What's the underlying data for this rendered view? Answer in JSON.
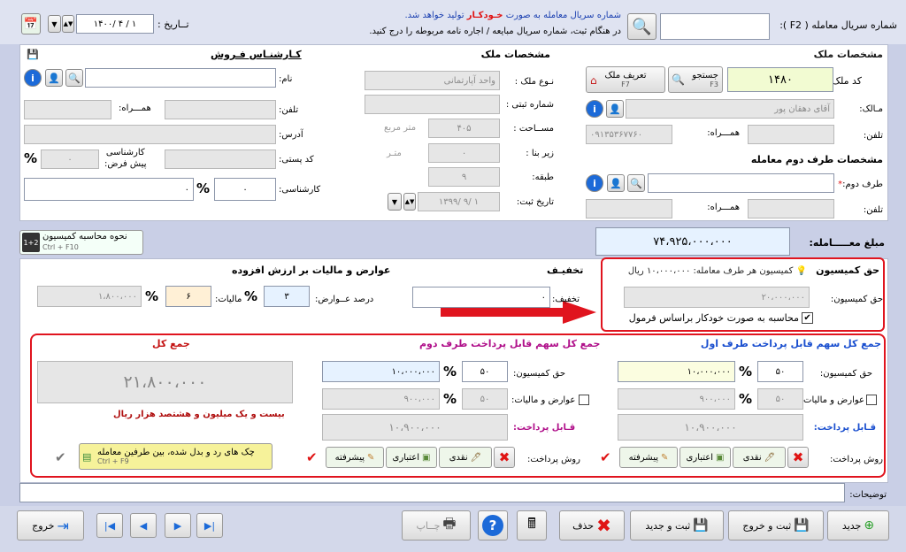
{
  "top": {
    "serial_label": "شماره سریال معامله ( F2 ):",
    "serial_value": "",
    "note1_a": "شماره سریال معامله به صورت",
    "note1_b": "خـودکـار",
    "note1_c": "تولید خواهد شد.",
    "note2": "در هنگام ثبت، شماره سریال مبایعه / اجاره نامه مربوطه را درج کنید.",
    "date_label": "تــاریخ :",
    "date_value": "۱۴۰۰/ ۴ / ۱"
  },
  "property": {
    "title": "مشخصات ملک",
    "code_label": "کد ملک :",
    "code_value": "۱۴۸۰",
    "search_btn": "جستجو",
    "search_key": "F3",
    "define_btn": "تعریف ملک",
    "define_key": "F7",
    "owner_label": "مـالک:",
    "owner_value": "آقای دهقان پور",
    "phone_label": "تلفن:",
    "mobile_label": "همـــراه:",
    "mobile_value": "۰۹۱۳۵۳۶۷۷۶۰"
  },
  "second_party": {
    "title": "مشخصات طرف دوم معامله",
    "party_label": "طرف دوم:",
    "phone_label": "تلفن:",
    "mobile_label": "همـــراه:"
  },
  "details": {
    "title": "مشخصات ملک",
    "type_label": "نـوع ملک :",
    "type_value": "واحد آپارتمانی",
    "reg_label": "شماره ثبتی :",
    "area_label": "مســاحت :",
    "area_value": "۴۰۵",
    "area_unit": "متر مربع",
    "built_label": "زیر بنا :",
    "built_value": "۰",
    "built_unit": "متـر",
    "floor_label": "طبقه:",
    "floor_value": "۹",
    "regdate_label": "تاریخ ثبت:",
    "regdate_value": "۱۳۹۹/ ۹/ ۱"
  },
  "agent": {
    "title": "کـارشنـاس فـروش",
    "name_label": "نام:",
    "phone_label": "تلفن:",
    "mobile_label": "همـــراه:",
    "address_label": "آدرس:",
    "postal_label": "کد پستی:",
    "default_label_1": "کارشناسی",
    "default_label_2": "پیش فرض:",
    "default_value": "۰",
    "expert_label": "کارشناسی:",
    "expert_pct": "۰",
    "expert_amount": "۰"
  },
  "calc_btn": {
    "label": "نحوه محاسبه کمیسیون",
    "key": "Ctrl + F10"
  },
  "amount": {
    "label": "مبلغ معـــــامله:",
    "value": "۷۴،۹۲۵،۰۰۰،۰۰۰"
  },
  "commission": {
    "title": "حق کمیسیون",
    "hint": "کمیسیون هر طرف معامله: ۱۰،۰۰۰،۰۰۰ ریال",
    "label": "حق کمیسیون:",
    "value": "۲۰،۰۰۰،۰۰۰",
    "auto_label": "محاسبه به صورت خودکار براساس فرمول"
  },
  "discount": {
    "title": "تخفیـف",
    "label": "تخفیف:",
    "value": "۰"
  },
  "tax": {
    "title": "عوارض و مالیات بر ارزش افزوده",
    "duty_label": "درصد عــوارض:",
    "duty_value": "۳",
    "tax_label": "مالیات:",
    "tax_value": "۶",
    "total_value": "۱،۸۰۰،۰۰۰"
  },
  "party1": {
    "title": "جمع کل سهم قابل پرداخت طرف اول",
    "comm_label": "حق کمیسیون:",
    "pct": "۵۰",
    "comm_value": "۱۰،۰۰۰،۰۰۰",
    "tax_label": "عوارض و مالیات:",
    "tax_pct": "۵۰",
    "tax_value": "۹۰۰،۰۰۰",
    "pay_label": "قـابل پرداخت:",
    "pay_value": "۱۰،۹۰۰،۰۰۰",
    "method_label": "روش پرداخت:",
    "cash": "نقدی",
    "credit": "اعتباری",
    "advanced": "پیشرفته"
  },
  "party2": {
    "title": "جمع کل سهم قابل پرداخت طرف دوم",
    "comm_label": "حق کمیسیون:",
    "pct": "۵۰",
    "comm_value": "۱۰،۰۰۰،۰۰۰",
    "tax_label": "عوارض و مالیات:",
    "tax_pct": "۵۰",
    "tax_value": "۹۰۰،۰۰۰",
    "pay_label": "قـابل پرداخت:",
    "pay_value": "۱۰،۹۰۰،۰۰۰",
    "method_label": "روش پرداخت:",
    "cash": "نقدی",
    "credit": "اعتباری",
    "advanced": "پیشرفته"
  },
  "total": {
    "title": "جمع کل",
    "value": "۲۱،۸۰۰،۰۰۰",
    "words": "بیست و یک میلیون و هشتصد هزار ریال",
    "cheques_btn": "چک های رد و بدل شده، بین طرفین معامله",
    "cheques_key": "Ctrl + F9"
  },
  "notes": {
    "label": "توضیحات:"
  },
  "toolbar": {
    "new": "جدید",
    "save_exit": "ثبت و خروج",
    "save_new": "ثبت و جدید",
    "delete": "حذف",
    "print": "چــاپ",
    "exit": "خروج"
  },
  "colors": {
    "red_outline": "#e0141e",
    "green_cell": "#f2fbd2",
    "blue_cell": "#e6f2ff",
    "orange_cell": "#fff0d6",
    "yellow_btn": "#f6f29a"
  }
}
